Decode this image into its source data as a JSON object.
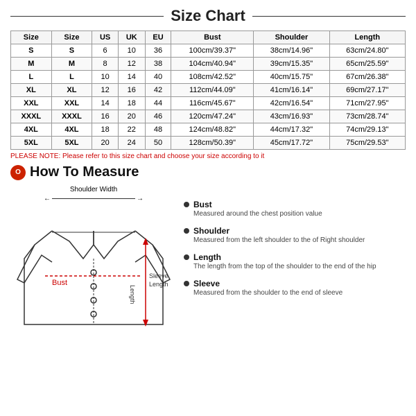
{
  "page": {
    "title": "Size Chart",
    "note": "PLEASE NOTE: Please refer to this size chart and choose your size according to it",
    "how_to_title": "How To Measure",
    "shoulder_width_label": "Shoulder Width",
    "bust_label": "Bust",
    "sleeve_length_label": "Sleeve\nLength",
    "length_label": "Length"
  },
  "table": {
    "headers": [
      "Size",
      "Size",
      "US",
      "UK",
      "EU",
      "Bust",
      "Shoulder",
      "Length"
    ],
    "rows": [
      [
        "S",
        "S",
        "6",
        "10",
        "36",
        "100cm/39.37\"",
        "38cm/14.96\"",
        "63cm/24.80\""
      ],
      [
        "M",
        "M",
        "8",
        "12",
        "38",
        "104cm/40.94\"",
        "39cm/15.35\"",
        "65cm/25.59\""
      ],
      [
        "L",
        "L",
        "10",
        "14",
        "40",
        "108cm/42.52\"",
        "40cm/15.75\"",
        "67cm/26.38\""
      ],
      [
        "XL",
        "XL",
        "12",
        "16",
        "42",
        "112cm/44.09\"",
        "41cm/16.14\"",
        "69cm/27.17\""
      ],
      [
        "XXL",
        "XXL",
        "14",
        "18",
        "44",
        "116cm/45.67\"",
        "42cm/16.54\"",
        "71cm/27.95\""
      ],
      [
        "XXXL",
        "XXXL",
        "16",
        "20",
        "46",
        "120cm/47.24\"",
        "43cm/16.93\"",
        "73cm/28.74\""
      ],
      [
        "4XL",
        "4XL",
        "18",
        "22",
        "48",
        "124cm/48.82\"",
        "44cm/17.32\"",
        "74cm/29.13\""
      ],
      [
        "5XL",
        "5XL",
        "20",
        "24",
        "50",
        "128cm/50.39\"",
        "45cm/17.72\"",
        "75cm/29.53\""
      ]
    ]
  },
  "descriptions": [
    {
      "title": "Bust",
      "body": "Measured around the chest position value"
    },
    {
      "title": "Shoulder",
      "body": "Measured from the left shoulder to the of Right shoulder"
    },
    {
      "title": "Length",
      "body": "The length from the top of the shoulder to the end of the hip"
    },
    {
      "title": "Sleeve",
      "body": "Measured from the shoulder to the end of sleeve"
    }
  ]
}
